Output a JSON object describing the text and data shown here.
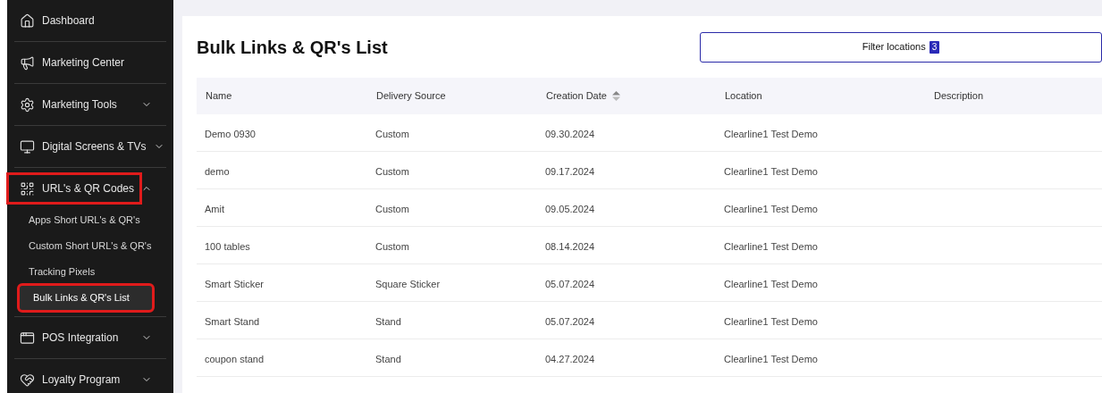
{
  "sidebar": {
    "items": [
      {
        "label": "Dashboard",
        "annotated": false
      },
      {
        "label": "Marketing Center",
        "annotated": false
      },
      {
        "label": "Marketing Tools",
        "expanded": false,
        "annotated": false
      },
      {
        "label": "Digital Screens & TVs",
        "expanded": false,
        "annotated": false
      },
      {
        "label": "URL's & QR Codes",
        "expanded": true,
        "annotated": true,
        "children": [
          {
            "label": "Apps Short URL's & QR's",
            "selected": false,
            "annotated": false
          },
          {
            "label": "Custom Short URL's & QR's",
            "selected": false,
            "annotated": false
          },
          {
            "label": "Tracking Pixels",
            "selected": false,
            "annotated": false
          },
          {
            "label": "Bulk Links & QR's List",
            "selected": true,
            "annotated": true
          }
        ]
      },
      {
        "label": "POS Integration",
        "expanded": false,
        "annotated": false
      },
      {
        "label": "Loyalty Program",
        "expanded": false,
        "annotated": false
      }
    ]
  },
  "page": {
    "title": "Bulk Links & QR's List",
    "filter_button": {
      "label": "Filter locations",
      "count": "3"
    }
  },
  "table": {
    "columns": [
      {
        "label": "Name",
        "sortable": false
      },
      {
        "label": "Delivery Source",
        "sortable": false
      },
      {
        "label": "Creation Date",
        "sortable": true
      },
      {
        "label": "Location",
        "sortable": false
      },
      {
        "label": "Description",
        "sortable": false
      }
    ],
    "rows": [
      [
        "Demo 0930",
        "Custom",
        "09.30.2024",
        "Clearline1 Test Demo"
      ],
      [
        "demo",
        "Custom",
        "09.17.2024",
        "Clearline1 Test Demo"
      ],
      [
        "Amit",
        "Custom",
        "09.05.2024",
        "Clearline1 Test Demo"
      ],
      [
        "100 tables",
        "Custom",
        "08.14.2024",
        "Clearline1 Test Demo"
      ],
      [
        "Smart Sticker",
        "Square Sticker",
        "05.07.2024",
        "Clearline1 Test Demo"
      ],
      [
        "Smart Stand",
        "Stand",
        "05.07.2024",
        "Clearline1 Test Demo"
      ],
      [
        "coupon stand",
        "Stand",
        "04.27.2024",
        "Clearline1 Test Demo"
      ]
    ]
  }
}
